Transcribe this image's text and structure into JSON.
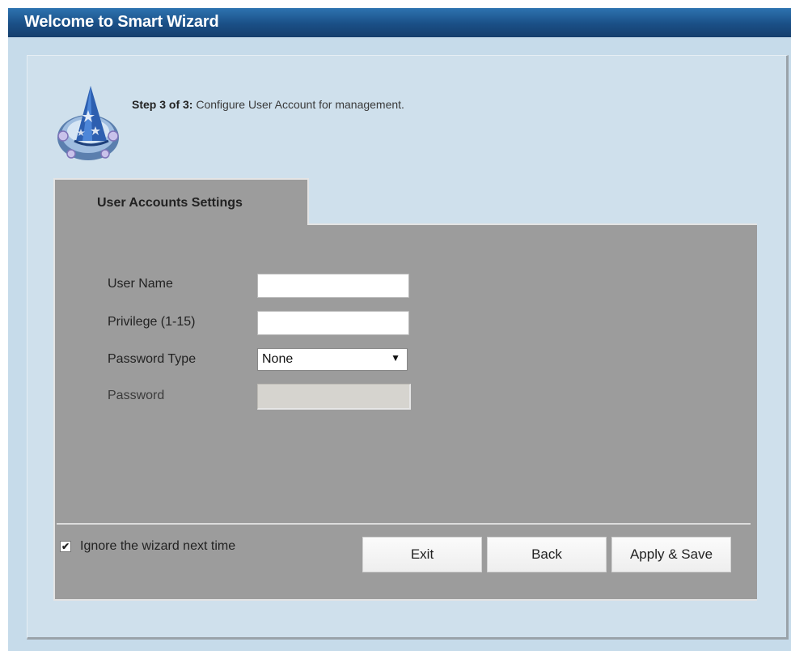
{
  "header": {
    "title": "Welcome to Smart Wizard"
  },
  "wizard": {
    "step_prefix": "Step 3 of 3:",
    "step_description": " Configure User Account for management.",
    "icon": "wizard-hat-icon"
  },
  "tab": {
    "label": "User Accounts Settings"
  },
  "form": {
    "user_name_label": "User Name",
    "user_name_value": "",
    "privilege_label": "Privilege (1-15)",
    "privilege_value": "",
    "password_type_label": "Password Type",
    "password_type_value": "None",
    "password_label": "Password",
    "password_value": ""
  },
  "footer": {
    "ignore_label": "Ignore the wizard next time",
    "ignore_checked": true,
    "check_glyph": "✔",
    "exit_label": "Exit",
    "back_label": "Back",
    "apply_label": "Apply & Save"
  },
  "colors": {
    "title_bar": "#1a4f86",
    "background": "#c6dbea",
    "content_panel": "#9c9c9c"
  }
}
